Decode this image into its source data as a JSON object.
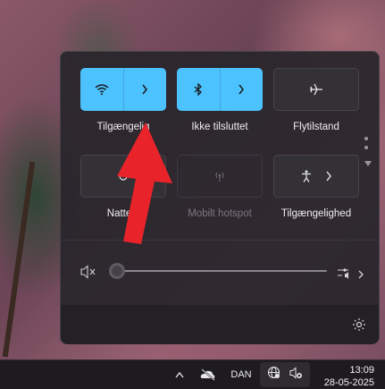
{
  "quick_settings": {
    "tiles_row1": [
      {
        "label": "Tilgængelig",
        "state": "on",
        "icon": "wifi-icon"
      },
      {
        "label": "Ikke tilsluttet",
        "state": "on",
        "icon": "bluetooth-icon"
      },
      {
        "label": "Flytilstand",
        "state": "off",
        "icon": "airplane-icon"
      }
    ],
    "tiles_row2": [
      {
        "label": "Natte s",
        "state": "off",
        "icon": "night-light-icon"
      },
      {
        "label": "Mobilt hotspot",
        "state": "disabled",
        "icon": "hotspot-icon"
      },
      {
        "label": "Tilgængelighed",
        "state": "off",
        "icon": "accessibility-icon"
      }
    ],
    "volume": {
      "level": 0,
      "icon": "speaker-muted-icon"
    }
  },
  "taskbar": {
    "language": "DAN",
    "time": "13:09",
    "date": "28-05-2025"
  },
  "colors": {
    "accent": "#4cc2ff",
    "annotation": "#e8242a"
  }
}
